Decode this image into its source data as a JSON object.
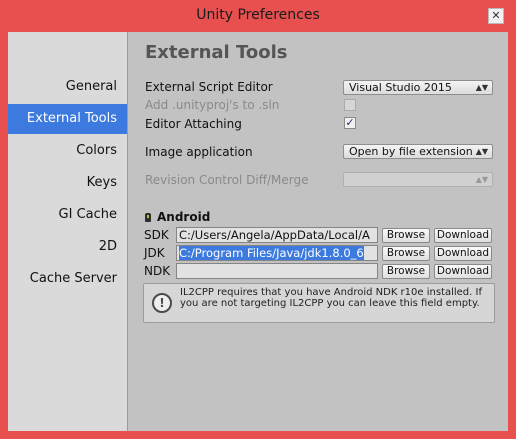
{
  "window": {
    "title": "Unity Preferences",
    "close_glyph": "✕"
  },
  "sidebar": {
    "items": [
      {
        "label": "General"
      },
      {
        "label": "External Tools"
      },
      {
        "label": "Colors"
      },
      {
        "label": "Keys"
      },
      {
        "label": "GI Cache"
      },
      {
        "label": "2D"
      },
      {
        "label": "Cache Server"
      }
    ],
    "selected": "External Tools"
  },
  "main": {
    "heading": "External Tools",
    "script_editor": {
      "label": "External Script Editor",
      "value": "Visual Studio 2015"
    },
    "add_unityproj": {
      "label": "Add .unityproj's to .sln",
      "checked": false,
      "disabled": true
    },
    "editor_attaching": {
      "label": "Editor Attaching",
      "checked": true,
      "check_glyph": "✓"
    },
    "image_app": {
      "label": "Image application",
      "value": "Open by file extension"
    },
    "revision_control": {
      "label": "Revision Control Diff/Merge",
      "value": "",
      "disabled": true
    },
    "dropdown_arrow_glyph": "▲▼",
    "android": {
      "title": "Android",
      "icon": "android-icon",
      "rows": [
        {
          "label": "SDK",
          "path": "C:/Users/Angela/AppData/Local/A",
          "browse": "Browse",
          "download": "Download"
        },
        {
          "label": "JDK",
          "path": "C:/Program Files/Java/jdk1.8.0_6",
          "browse": "Browse",
          "download": "Download"
        },
        {
          "label": "NDK",
          "path": "",
          "browse": "Browse",
          "download": "Download"
        }
      ]
    },
    "help": {
      "icon": "info-icon",
      "icon_glyph": "!",
      "text": "IL2CPP requires that you have Android NDK r10e installed. If you are not targeting IL2CPP you can leave this field empty."
    }
  },
  "colors": {
    "window_border": "#e84f4f",
    "selection": "#3d7ae0",
    "panel": "#c2c2c2",
    "sidebar": "#dadada"
  }
}
